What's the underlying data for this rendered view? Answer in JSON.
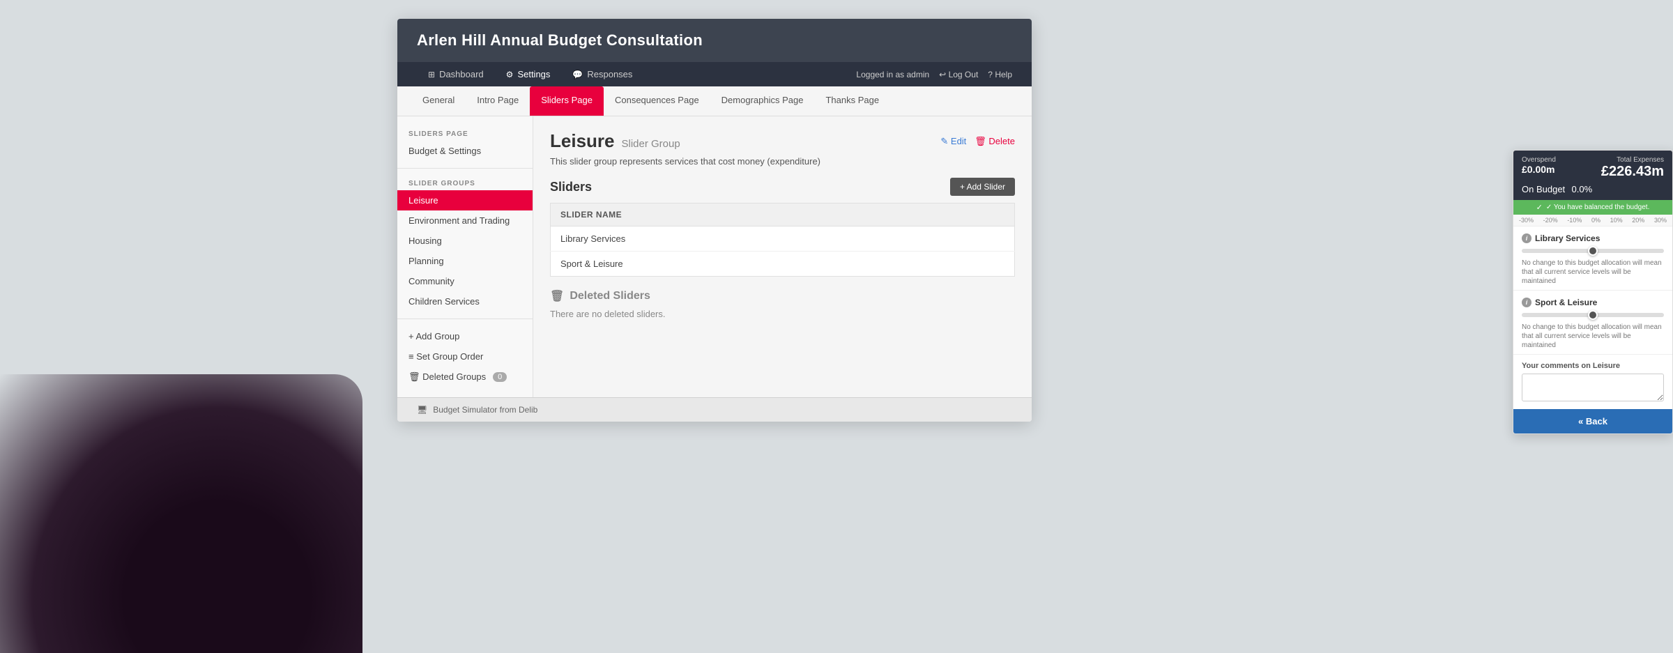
{
  "app": {
    "title": "Arlen Hill Annual Budget Consultation",
    "background_color": "#d8dde0"
  },
  "nav": {
    "dashboard_label": "Dashboard",
    "settings_label": "Settings",
    "responses_label": "Responses",
    "logged_in_label": "Logged in as admin",
    "logout_label": "Log Out",
    "help_label": "Help"
  },
  "tabs": [
    {
      "id": "general",
      "label": "General",
      "active": false
    },
    {
      "id": "intro",
      "label": "Intro Page",
      "active": false
    },
    {
      "id": "sliders",
      "label": "Sliders Page",
      "active": true
    },
    {
      "id": "consequences",
      "label": "Consequences Page",
      "active": false
    },
    {
      "id": "demographics",
      "label": "Demographics Page",
      "active": false
    },
    {
      "id": "thanks",
      "label": "Thanks Page",
      "active": false
    }
  ],
  "sidebar": {
    "sliders_page_section": "SLIDERS PAGE",
    "budget_settings_label": "Budget & Settings",
    "slider_groups_section": "SLIDER GROUPS",
    "groups": [
      {
        "id": "leisure",
        "label": "Leisure",
        "active": true
      },
      {
        "id": "environment",
        "label": "Environment and Trading",
        "active": false
      },
      {
        "id": "housing",
        "label": "Housing",
        "active": false
      },
      {
        "id": "planning",
        "label": "Planning",
        "active": false
      },
      {
        "id": "community",
        "label": "Community",
        "active": false
      },
      {
        "id": "children",
        "label": "Children Services",
        "active": false
      }
    ],
    "add_group_label": "+ Add Group",
    "set_group_order_label": "≡ Set Group Order",
    "deleted_groups_label": "🗑 Deleted Groups",
    "deleted_groups_count": "0"
  },
  "main": {
    "group_name": "Leisure",
    "group_subtitle": "Slider Group",
    "group_description": "This slider group represents services that cost money (expenditure)",
    "edit_label": "✎ Edit",
    "delete_label": "🗑 Delete",
    "sliders_title": "Sliders",
    "add_slider_btn": "+ Add Slider",
    "table_header_slider_name": "Slider Name",
    "sliders": [
      {
        "name": "Library Services"
      },
      {
        "name": "Sport & Leisure"
      }
    ],
    "deleted_sliders_title": "Deleted Sliders",
    "deleted_sliders_note": "There are no deleted sliders."
  },
  "budget_panel": {
    "overspend_label": "Overspend",
    "overspend_value": "£0.00m",
    "total_expenses_label": "Total Expenses",
    "total_expenses_value": "£226.43m",
    "on_budget_label": "On Budget",
    "on_budget_value": "0.0%",
    "balanced_message": "✓ You have balanced the budget.",
    "scale_labels": [
      "-30%",
      "-20%",
      "-10%",
      "0%",
      "10%",
      "20%",
      "30%"
    ],
    "services": [
      {
        "name": "Library Services",
        "note": "No change to this budget allocation will mean that all current service levels will be maintained"
      },
      {
        "name": "Sport & Leisure",
        "note": "No change to this budget allocation will mean that all current service levels will be maintained"
      }
    ],
    "comments_label": "Your comments on Leisure",
    "comments_placeholder": "",
    "back_button_label": "« Back"
  },
  "footer": {
    "label": "Budget Simulator from Delib"
  }
}
